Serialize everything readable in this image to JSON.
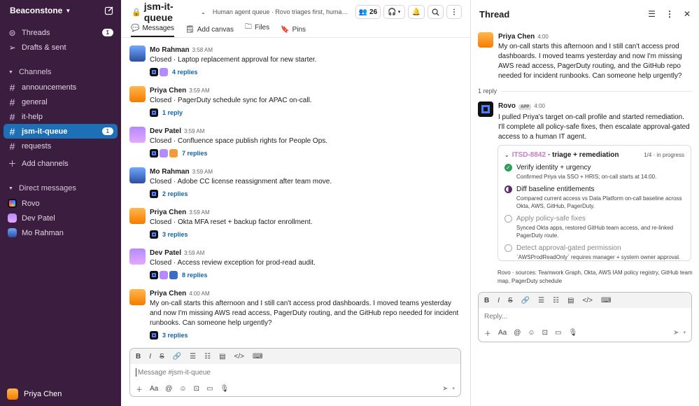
{
  "workspace": {
    "name": "Beaconstone"
  },
  "sidebar": {
    "top_items": [
      {
        "label": "Threads",
        "badge": "1"
      },
      {
        "label": "Drafts & sent"
      }
    ],
    "channels_header": "Channels",
    "channels": [
      {
        "label": "announcements"
      },
      {
        "label": "general"
      },
      {
        "label": "it-help"
      },
      {
        "label": "jsm-it-queue",
        "badge": "1"
      },
      {
        "label": "requests"
      }
    ],
    "add_channels": "Add channels",
    "dm_header": "Direct messages",
    "dms": [
      {
        "label": "Rovo"
      },
      {
        "label": "Dev Patel"
      },
      {
        "label": "Mo Rahman"
      }
    ],
    "current_user": "Priya Chen"
  },
  "channel": {
    "name": "jsm-it-queue",
    "description": "Human agent queue · Rovo triages first, humans step in for approvals",
    "member_count": "26",
    "tabs": [
      {
        "label": "Messages"
      },
      {
        "label": "Add canvas"
      },
      {
        "label": "Files"
      },
      {
        "label": "Pins"
      }
    ]
  },
  "messages": [
    {
      "author": "Mo Rahman",
      "time": "3:58 AM",
      "text": "Closed · Laptop replacement approval for new starter.",
      "replies": "4 replies"
    },
    {
      "author": "Priya Chen",
      "time": "3:59 AM",
      "text": "Closed · PagerDuty schedule sync for APAC on-call.",
      "replies": "1 reply"
    },
    {
      "author": "Dev Patel",
      "time": "3:59 AM",
      "text": "Closed · Confluence space publish rights for People Ops.",
      "replies": "7 replies"
    },
    {
      "author": "Mo Rahman",
      "time": "3:59 AM",
      "text": "Closed · Adobe CC license reassignment after team move.",
      "replies": "2 replies"
    },
    {
      "author": "Priya Chen",
      "time": "3:59 AM",
      "text": "Closed · Okta MFA reset + backup factor enrollment.",
      "replies": "3 replies"
    },
    {
      "author": "Dev Patel",
      "time": "3:59 AM",
      "text": "Closed · Access review exception for prod-read audit.",
      "replies": "8 replies"
    },
    {
      "author": "Priya Chen",
      "time": "4:00 AM",
      "text": "My on-call starts this afternoon and I still can't access prod dashboards. I moved teams yesterday and now I'm missing AWS read access, PagerDuty routing, and the GitHub repo needed for incident runbooks. Can someone help urgently?",
      "replies": "3 replies"
    }
  ],
  "composer": {
    "placeholder": "Message #jsm-it-queue"
  },
  "thread": {
    "title": "Thread",
    "parent": {
      "author": "Priya Chen",
      "time": "4:00",
      "text": "My on-call starts this afternoon and I still can't access prod dashboards. I moved teams yesterday and now I'm missing AWS read access, PagerDuty routing, and the GitHub repo needed for incident runbooks. Can someone help urgently?"
    },
    "reply_count": "1 reply",
    "reply": {
      "author": "Rovo",
      "tag": "APP",
      "time": "4:00",
      "text": "I pulled Priya's target on-call profile and started remediation. I'll complete all policy-safe fixes, then escalate approval-gated access to a human IT agent."
    },
    "card": {
      "ticket": "ITSD-8842",
      "title": "· triage + remediation",
      "status": "1/4 · in progress",
      "steps": [
        {
          "title": "Verify identity + urgency",
          "desc": "Confirmed Priya via SSO + HRIS; on-call starts at 14:00.",
          "state": "done"
        },
        {
          "title": "Diff baseline entitlements",
          "desc": "Compared current access vs Data Platform on-call baseline across Okta, AWS, GitHub, PagerDuty.",
          "state": "active"
        },
        {
          "title": "Apply policy-safe fixes",
          "desc": "Synced Okta apps, restored GitHub team access, and re-linked PagerDuty route.",
          "state": "pending"
        },
        {
          "title": "Detect approval-gated permission",
          "desc": "`AWSProdReadOnly` requires manager + system owner approval.",
          "state": "pending"
        }
      ]
    },
    "sources": "Rovo · sources: Teamwork Graph, Okta, AWS IAM policy registry, GitHub team map, PagerDuty schedule",
    "composer_placeholder": "Reply..."
  }
}
